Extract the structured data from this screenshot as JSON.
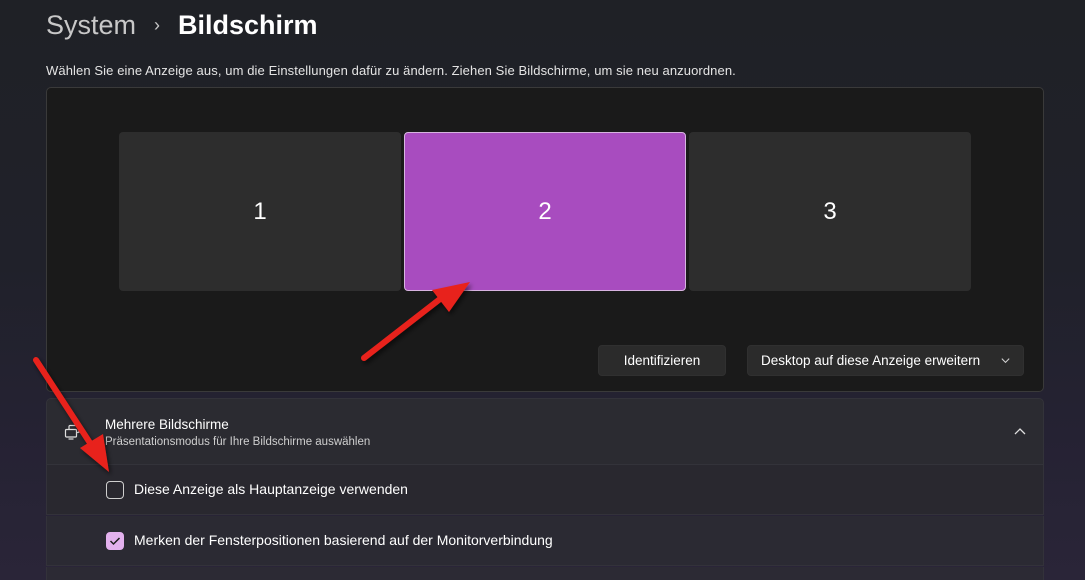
{
  "breadcrumb": {
    "parent": "System",
    "separator": "›",
    "current": "Bildschirm"
  },
  "subtitle": "Wählen Sie eine Anzeige aus, um die Einstellungen dafür zu ändern. Ziehen Sie Bildschirme, um sie neu anzuordnen.",
  "monitors": [
    {
      "label": "1",
      "selected": false
    },
    {
      "label": "2",
      "selected": true
    },
    {
      "label": "3",
      "selected": false
    }
  ],
  "buttons": {
    "identify": "Identifizieren",
    "extend_dropdown": "Desktop auf diese Anzeige erweitern"
  },
  "multi_display": {
    "title": "Mehrere Bildschirme",
    "description": "Präsentationsmodus für Ihre Bildschirme auswählen",
    "expanded": true,
    "icon": "multi-display-icon",
    "options": [
      {
        "label": "Diese Anzeige als Hauptanzeige verwenden",
        "checked": false
      },
      {
        "label": "Merken der Fensterpositionen basierend auf der Monitorverbindung",
        "checked": true
      }
    ]
  },
  "colors": {
    "selected_monitor": "#a84cbf",
    "checkbox_accent": "#e3b1ee",
    "annotation_arrow": "#e8231b"
  },
  "annotations": [
    "red-arrow-to-monitor-2",
    "red-arrow-to-main-display-checkbox"
  ]
}
